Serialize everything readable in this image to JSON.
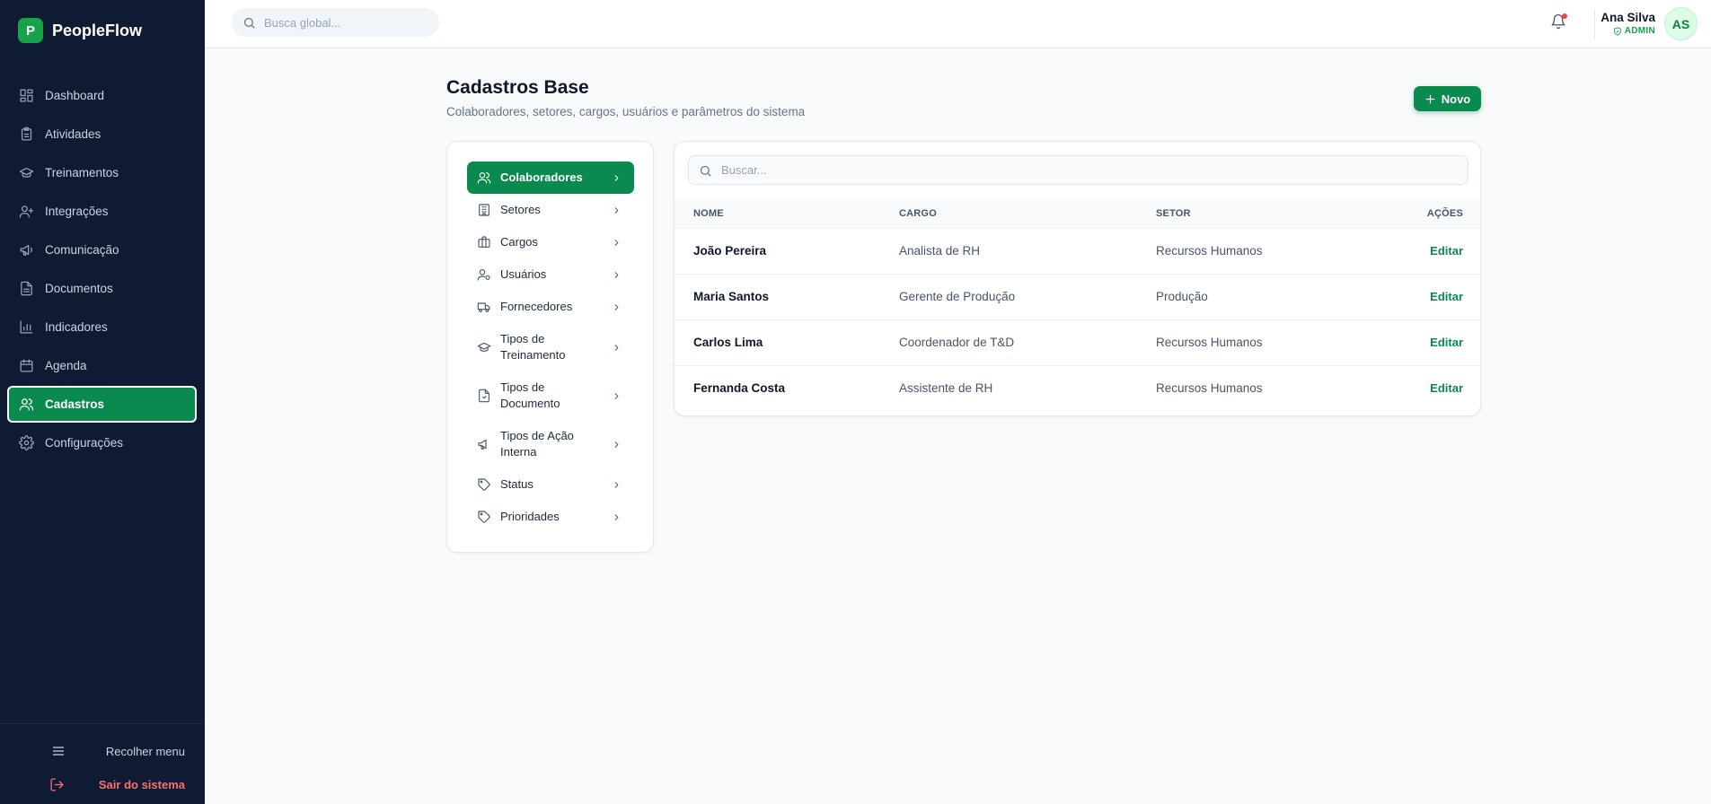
{
  "app": {
    "logo_letter": "P",
    "name": "PeopleFlow"
  },
  "sidebar": {
    "items": [
      {
        "label": "Dashboard",
        "icon": "dashboard-icon"
      },
      {
        "label": "Atividades",
        "icon": "clipboard-icon"
      },
      {
        "label": "Treinamentos",
        "icon": "graduation-cap-icon"
      },
      {
        "label": "Integrações",
        "icon": "user-plus-icon"
      },
      {
        "label": "Comunicação",
        "icon": "megaphone-icon"
      },
      {
        "label": "Documentos",
        "icon": "document-icon"
      },
      {
        "label": "Indicadores",
        "icon": "bar-chart-icon"
      },
      {
        "label": "Agenda",
        "icon": "calendar-icon"
      },
      {
        "label": "Cadastros",
        "icon": "users-icon",
        "active": true
      },
      {
        "label": "Configurações",
        "icon": "gear-icon"
      }
    ],
    "collapse_label": "Recolher menu",
    "logout_label": "Sair do sistema"
  },
  "topbar": {
    "search_placeholder": "Busca global...",
    "user_name": "Ana Silva",
    "user_role": "ADMIN",
    "user_initials": "AS"
  },
  "page": {
    "title": "Cadastros Base",
    "subtitle": "Colaboradores, setores, cargos, usuários e parâmetros do sistema",
    "new_button_label": "Novo"
  },
  "categories": [
    {
      "label": "Colaboradores",
      "icon": "users-icon",
      "active": true
    },
    {
      "label": "Setores",
      "icon": "building-icon"
    },
    {
      "label": "Cargos",
      "icon": "briefcase-icon"
    },
    {
      "label": "Usuários",
      "icon": "user-cog-icon"
    },
    {
      "label": "Fornecedores",
      "icon": "truck-icon"
    },
    {
      "label_lines": [
        "Tipos de",
        "Treinamento"
      ],
      "icon": "graduation-cap-icon"
    },
    {
      "label_lines": [
        "Tipos de",
        "Documento"
      ],
      "icon": "file-icon"
    },
    {
      "label_lines": [
        "Tipos de Ação",
        "Interna"
      ],
      "icon": "megaphone-icon"
    },
    {
      "label": "Status",
      "icon": "tag-icon"
    },
    {
      "label": "Prioridades",
      "icon": "tag-icon"
    }
  ],
  "table": {
    "search_placeholder": "Buscar...",
    "headers": [
      "NOME",
      "CARGO",
      "SETOR",
      "AÇÕES"
    ],
    "rows": [
      {
        "nome": "João Pereira",
        "cargo": "Analista de RH",
        "setor": "Recursos Humanos",
        "acao": "Editar"
      },
      {
        "nome": "Maria Santos",
        "cargo": "Gerente de Produção",
        "setor": "Produção",
        "acao": "Editar"
      },
      {
        "nome": "Carlos Lima",
        "cargo": "Coordenador de T&D",
        "setor": "Recursos Humanos",
        "acao": "Editar"
      },
      {
        "nome": "Fernanda Costa",
        "cargo": "Assistente de RH",
        "setor": "Recursos Humanos",
        "acao": "Editar"
      }
    ]
  },
  "colors": {
    "accent": "#0a8a4e",
    "sidebar_bg": "#0f1b33",
    "danger": "#f87171"
  }
}
